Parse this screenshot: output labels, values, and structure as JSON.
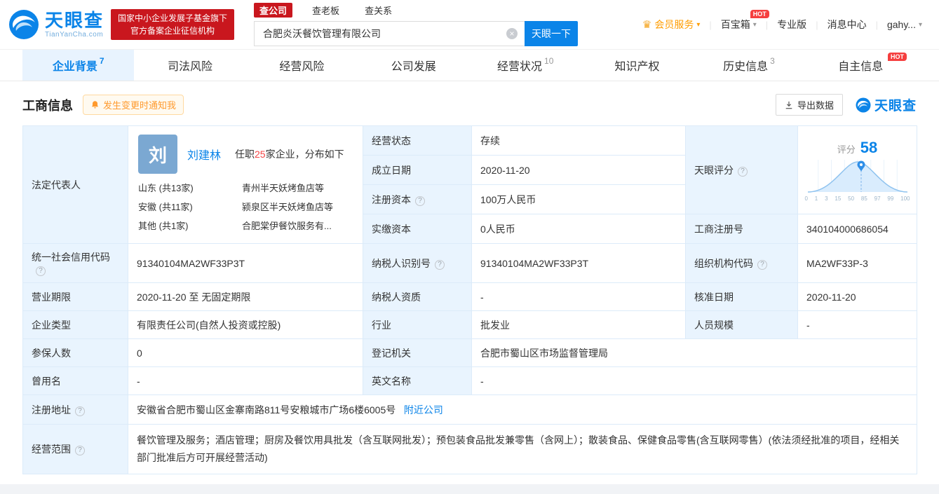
{
  "icons": {
    "help": "?",
    "caret": "▾",
    "clear": "×",
    "crown": "♛",
    "hot": "HOT"
  },
  "header": {
    "brand": "天眼查",
    "brand_domain": "TianYanCha.com",
    "gov_badge_line1": "国家中小企业发展子基金旗下",
    "gov_badge_line2": "官方备案企业征信机构",
    "search": {
      "tabs": [
        "查公司",
        "查老板",
        "查关系"
      ],
      "value": "合肥炎沃餐饮管理有限公司",
      "button": "天眼一下"
    },
    "nav": [
      "会员服务",
      "百宝箱",
      "专业版",
      "消息中心",
      "gahy..."
    ]
  },
  "tabs": [
    {
      "label": "企业背景",
      "count": "7"
    },
    {
      "label": "司法风险"
    },
    {
      "label": "经营风险"
    },
    {
      "label": "公司发展"
    },
    {
      "label": "经营状况",
      "count": "10"
    },
    {
      "label": "知识产权"
    },
    {
      "label": "历史信息",
      "count": "3"
    },
    {
      "label": "自主信息"
    }
  ],
  "section": {
    "title": "工商信息",
    "notify": "发生变更时通知我",
    "export": "导出数据",
    "watermark": "天眼查"
  },
  "legal_rep": {
    "label": "法定代表人",
    "avatar": "刘",
    "name": "刘建林",
    "tenure_prefix": "任职",
    "tenure_count": "25",
    "tenure_suffix": "家企业，分布如下",
    "distribution": [
      {
        "region": "山东 (共13家)",
        "company": "青州半天妖烤鱼店等"
      },
      {
        "region": "安徽 (共11家)",
        "company": "颍泉区半天妖烤鱼店等"
      },
      {
        "region": "其他 (共1家)",
        "company": "合肥棠伊餐饮服务有..."
      }
    ]
  },
  "score": {
    "label": "天眼评分",
    "prefix": "评分",
    "value": "58",
    "axis": [
      "0",
      "1",
      "3",
      "15",
      "50",
      "85",
      "97",
      "99",
      "100"
    ]
  },
  "fields": {
    "status": {
      "label": "经营状态",
      "value": "存续"
    },
    "established": {
      "label": "成立日期",
      "value": "2020-11-20"
    },
    "reg_capital": {
      "label": "注册资本",
      "value": "100万人民币"
    },
    "paid_capital": {
      "label": "实缴资本",
      "value": "0人民币"
    },
    "reg_no": {
      "label": "工商注册号",
      "value": "340104000686054"
    },
    "credit_code": {
      "label": "统一社会信用代码",
      "value": "91340104MA2WF33P3T"
    },
    "taxpayer_no": {
      "label": "纳税人识别号",
      "value": "91340104MA2WF33P3T"
    },
    "org_code": {
      "label": "组织机构代码",
      "value": "MA2WF33P-3"
    },
    "term": {
      "label": "营业期限",
      "value": "2020-11-20 至 无固定期限"
    },
    "taxpayer_quality": {
      "label": "纳税人资质",
      "value": "-"
    },
    "approved": {
      "label": "核准日期",
      "value": "2020-11-20"
    },
    "type": {
      "label": "企业类型",
      "value": "有限责任公司(自然人投资或控股)"
    },
    "industry": {
      "label": "行业",
      "value": "批发业"
    },
    "staff": {
      "label": "人员规模",
      "value": "-"
    },
    "insured": {
      "label": "参保人数",
      "value": "0"
    },
    "authority": {
      "label": "登记机关",
      "value": "合肥市蜀山区市场监督管理局"
    },
    "former_name": {
      "label": "曾用名",
      "value": "-"
    },
    "english_name": {
      "label": "英文名称",
      "value": "-"
    },
    "address": {
      "label": "注册地址",
      "value": "安徽省合肥市蜀山区金寨南路811号安粮城市广场6楼6005号",
      "link": "附近公司"
    },
    "scope": {
      "label": "经营范围",
      "value": "餐饮管理及服务；酒店管理；厨房及餐饮用具批发（含互联网批发）；预包装食品批发兼零售（含网上）；散装食品、保健食品零售(含互联网零售）(依法须经批准的项目，经相关部门批准后方可开展经营活动)"
    }
  }
}
